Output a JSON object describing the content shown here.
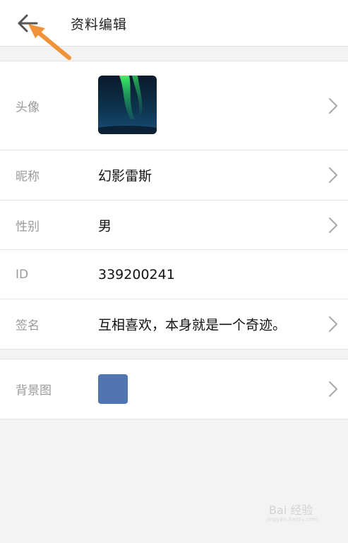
{
  "header": {
    "title": "资料编辑",
    "back_icon": "arrow-left-icon"
  },
  "profile": {
    "avatar": {
      "label": "头像",
      "icon": "aurora-avatar-image"
    },
    "nickname": {
      "label": "昵称",
      "value": "幻影雷斯"
    },
    "gender": {
      "label": "性别",
      "value": "男"
    },
    "id": {
      "label": "ID",
      "value": "339200241"
    },
    "signature": {
      "label": "签名",
      "value": "互相喜欢，本身就是一个奇迹。"
    }
  },
  "background": {
    "label": "背景图",
    "swatch_color": "#5175b0"
  },
  "watermark": {
    "text": "Bai 经验",
    "sub": "jingyan.baidu.com"
  },
  "colors": {
    "annotation_arrow": "#f0923a",
    "page_background": "#f3f3f3"
  }
}
